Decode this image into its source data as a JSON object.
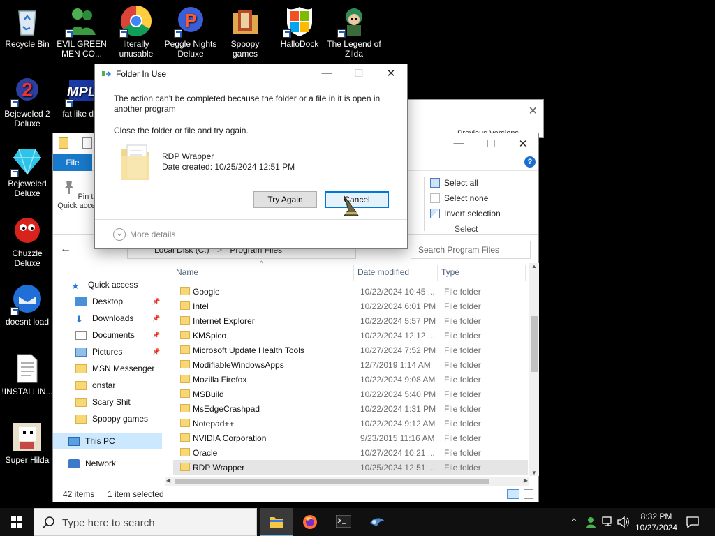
{
  "desktop": {
    "icons": [
      {
        "label": "Recycle Bin",
        "icon": "recycle-bin-icon"
      },
      {
        "label": "EVIL GREEN MEN CO...",
        "icon": "green-men-icon"
      },
      {
        "label": "literally unusable",
        "icon": "chrome-icon"
      },
      {
        "label": "Peggle Nights Deluxe",
        "icon": "peggle-icon"
      },
      {
        "label": "Spoopy games",
        "icon": "folder-icon"
      },
      {
        "label": "HalloDock",
        "icon": "windows-logo-icon"
      },
      {
        "label": "The Legend of Zilda",
        "icon": "zilda-icon"
      },
      {
        "label": "Bejeweled 2 Deluxe",
        "icon": "bejeweled2-icon"
      },
      {
        "label": "fat like dar",
        "icon": "mpl-icon"
      },
      {
        "label": "Bejeweled Deluxe",
        "icon": "gem-icon"
      },
      {
        "label": "Chuzzle Deluxe",
        "icon": "chuzzle-icon"
      },
      {
        "label": "doesnt load",
        "icon": "thunderbird-icon"
      },
      {
        "label": "!INSTALLIN...",
        "icon": "text-file-icon"
      },
      {
        "label": "Super Hilda",
        "icon": "hilda-icon"
      }
    ]
  },
  "back_window": {
    "tab_text": "Previous Versions"
  },
  "explorer": {
    "file_tab": "File",
    "pin_label": "Pin to Quick access",
    "select": {
      "select_all": "Select all",
      "select_none": "Select none",
      "invert_selection": "Invert selection",
      "group_label": "Select"
    },
    "address": {
      "drive": "Local Disk (C:)",
      "sep": ">",
      "folder": "Program Files"
    },
    "search_placeholder": "Search Program Files",
    "nav": [
      {
        "label": "Quick access",
        "icon": "star-icon",
        "pinned": false
      },
      {
        "label": "Desktop",
        "icon": "desktop-folder-icon",
        "pinned": true
      },
      {
        "label": "Downloads",
        "icon": "download-icon",
        "pinned": true
      },
      {
        "label": "Documents",
        "icon": "documents-icon",
        "pinned": true
      },
      {
        "label": "Pictures",
        "icon": "pictures-icon",
        "pinned": true
      },
      {
        "label": "MSN Messenger",
        "icon": "folder-icon",
        "pinned": false
      },
      {
        "label": "onstar",
        "icon": "folder-icon",
        "pinned": false
      },
      {
        "label": "Scary Shit",
        "icon": "folder-icon",
        "pinned": false
      },
      {
        "label": "Spoopy games",
        "icon": "folder-icon",
        "pinned": false
      },
      {
        "label": "This PC",
        "icon": "computer-icon",
        "pinned": false
      },
      {
        "label": "Network",
        "icon": "network-icon",
        "pinned": false
      }
    ],
    "columns": {
      "name": "Name",
      "date": "Date modified",
      "type": "Type"
    },
    "rows": [
      {
        "name": "Google",
        "date": "10/22/2024 10:45 ...",
        "type": "File folder"
      },
      {
        "name": "Intel",
        "date": "10/22/2024 6:01 PM",
        "type": "File folder"
      },
      {
        "name": "Internet Explorer",
        "date": "10/22/2024 5:57 PM",
        "type": "File folder"
      },
      {
        "name": "KMSpico",
        "date": "10/22/2024 12:12 ...",
        "type": "File folder"
      },
      {
        "name": "Microsoft Update Health Tools",
        "date": "10/27/2024 7:52 PM",
        "type": "File folder"
      },
      {
        "name": "ModifiableWindowsApps",
        "date": "12/7/2019 1:14 AM",
        "type": "File folder"
      },
      {
        "name": "Mozilla Firefox",
        "date": "10/22/2024 9:08 AM",
        "type": "File folder"
      },
      {
        "name": "MSBuild",
        "date": "10/22/2024 5:40 PM",
        "type": "File folder"
      },
      {
        "name": "MsEdgeCrashpad",
        "date": "10/22/2024 1:31 PM",
        "type": "File folder"
      },
      {
        "name": "Notepad++",
        "date": "10/22/2024 9:12 AM",
        "type": "File folder"
      },
      {
        "name": "NVIDIA Corporation",
        "date": "9/23/2015 11:16 AM",
        "type": "File folder"
      },
      {
        "name": "Oracle",
        "date": "10/27/2024 10:21 ...",
        "type": "File folder"
      },
      {
        "name": "RDP Wrapper",
        "date": "10/25/2024 12:51 ...",
        "type": "File folder"
      }
    ],
    "status_items": "42 items",
    "status_selected": "1 item selected"
  },
  "dialog": {
    "title": "Folder In Use",
    "message": "The action can't be completed because the folder or a file in it is open in another program",
    "message2": "Close the folder or file and try again.",
    "file_name": "RDP Wrapper",
    "file_date": "Date created: 10/25/2024 12:51 PM",
    "try_again": "Try Again",
    "cancel": "Cancel",
    "more_details": "More details"
  },
  "taskbar": {
    "search_placeholder": "Type here to search",
    "time": "8:32 PM",
    "date": "10/27/2024"
  }
}
